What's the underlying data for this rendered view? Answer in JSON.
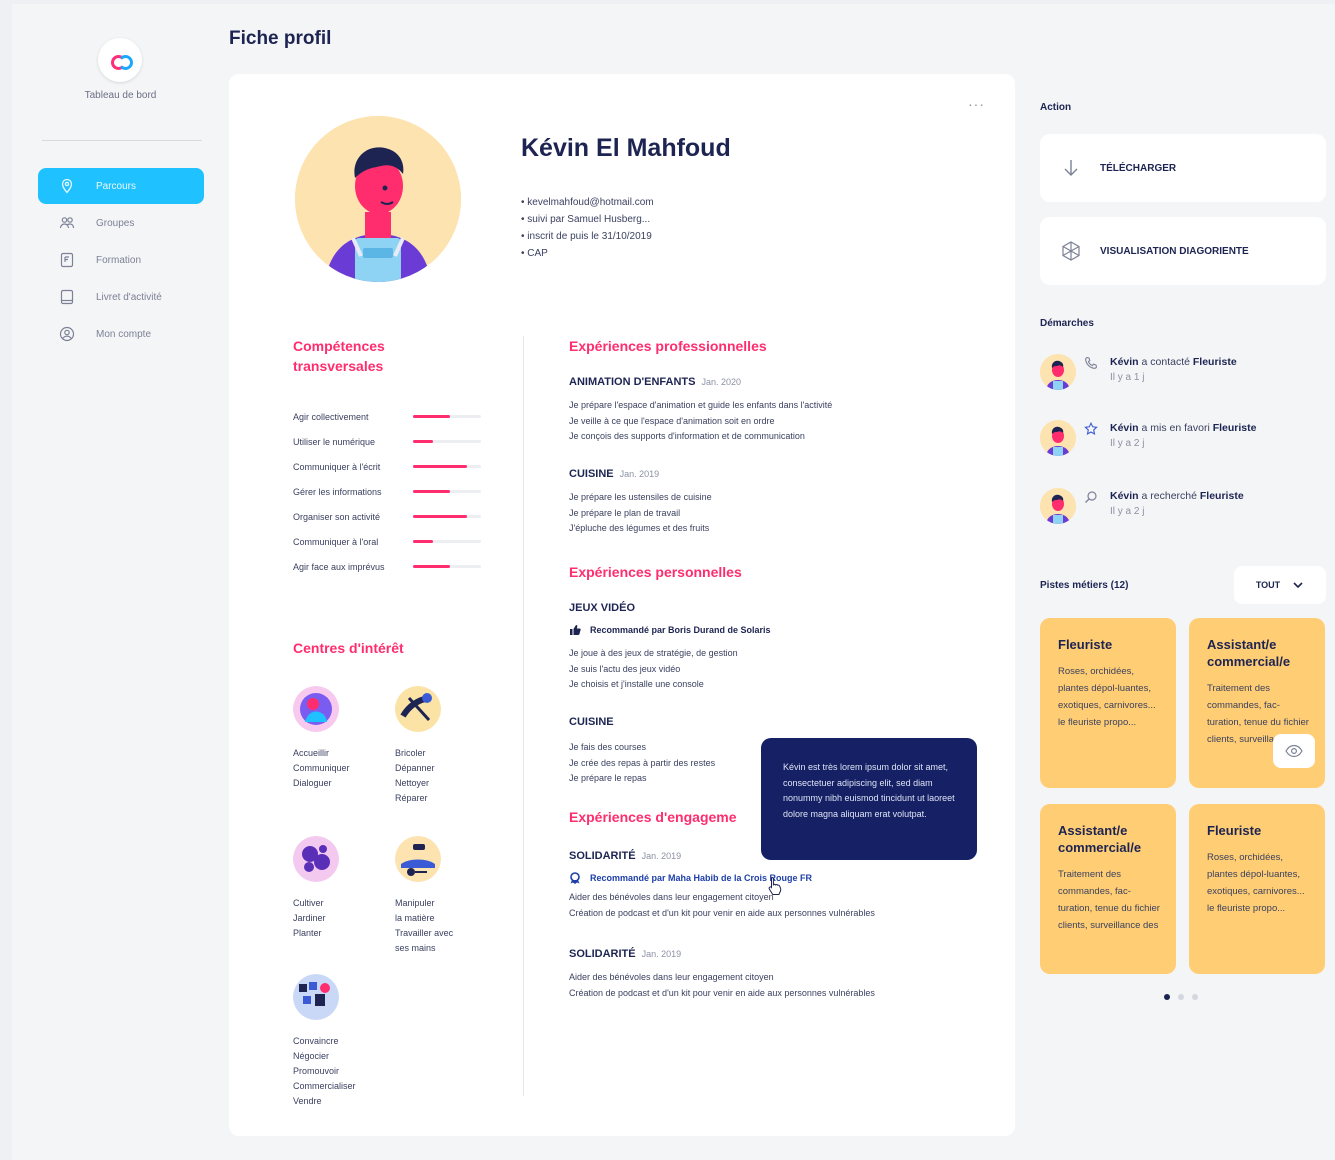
{
  "sidebar": {
    "logo_label": "Tableau de bord",
    "items": [
      {
        "label": "Parcours",
        "icon": "map-pin-icon",
        "active": true
      },
      {
        "label": "Groupes",
        "icon": "users-icon"
      },
      {
        "label": "Formation",
        "icon": "formation-icon"
      },
      {
        "label": "Livret d'activité",
        "icon": "book-icon"
      },
      {
        "label": "Mon compte",
        "icon": "user-circle-icon"
      }
    ]
  },
  "page": {
    "title": "Fiche profil"
  },
  "profile": {
    "more": "···",
    "name": "Kévin El Mahfoud",
    "meta": [
      "kevelmahfoud@hotmail.com",
      "suivi par Samuel Husberg...",
      "inscrit de puis le 31/10/2019",
      "CAP"
    ]
  },
  "skills": {
    "title_line1": "Compétences",
    "title_line2": "transversales",
    "items": [
      {
        "label": "Agir collectivement",
        "level": 0.55
      },
      {
        "label": "Utiliser le numérique",
        "level": 0.3
      },
      {
        "label": "Communiquer à l'écrit",
        "level": 0.8
      },
      {
        "label": "Gérer les informations",
        "level": 0.55
      },
      {
        "label": "Organiser son activité",
        "level": 0.8
      },
      {
        "label": "Communiquer à l'oral",
        "level": 0.3
      },
      {
        "label": "Agir face aux imprévus",
        "level": 0.55
      }
    ]
  },
  "interests": {
    "title": "Centres d'intérêt",
    "items": [
      {
        "lines": [
          "Accueillir",
          "Communiquer",
          "Dialoguer"
        ]
      },
      {
        "lines": [
          "Bricoler",
          "Dépanner",
          "Nettoyer",
          "Réparer"
        ]
      },
      {
        "lines": [
          "Cultiver",
          "Jardiner",
          "Planter"
        ]
      },
      {
        "lines": [
          "Manipuler",
          "la matière",
          "Travailler avec",
          "ses mains"
        ]
      },
      {
        "lines": [
          "Convaincre",
          "Négocier",
          "Promouvoir",
          "Commercialiser",
          "Vendre"
        ]
      }
    ]
  },
  "experiences": {
    "pro_title": "Expériences professionnelles",
    "pro": [
      {
        "title": "ANIMATION D'ENFANTS",
        "date": "Jan. 2020",
        "lines": [
          "Je prépare l'espace d'animation et guide les enfants dans l'activité",
          "Je veille à ce que l'espace d'animation soit en ordre",
          "Je conçois des supports d'information et de communication"
        ]
      },
      {
        "title": "CUISINE",
        "date": "Jan. 2019",
        "lines": [
          "Je prépare les ustensiles de cuisine",
          "Je prépare le plan de travail",
          "J'épluche des légumes et des fruits"
        ]
      }
    ],
    "perso_title": "Expériences personnelles",
    "perso": [
      {
        "title": "JEUX VIDÉO",
        "reco": "Recommandé par Boris Durand de Solaris",
        "lines": [
          "Je joue à des jeux de stratégie, de gestion",
          "Je suis l'actu des jeux vidéo",
          "Je choisis et j'installe une console"
        ]
      },
      {
        "title": "CUISINE",
        "lines": [
          "Je fais des courses",
          "Je crée des repas à partir des restes",
          "Je prépare le repas"
        ]
      }
    ],
    "engage_title": "Expériences d'engageme",
    "engage": [
      {
        "title": "SOLIDARITÉ",
        "date": "Jan. 2019",
        "reco": "Recommandé par Maha Habib de la Crois Rouge FR",
        "lines": [
          "Aider des bénévoles dans leur engagement citoyen",
          "Création de podcast et d'un kit pour venir en aide aux personnes vulnérables"
        ]
      },
      {
        "title": "SOLIDARITÉ",
        "date": "Jan. 2019",
        "lines": [
          "Aider des bénévoles dans leur engagement citoyen",
          "Création de podcast et d'un kit pour venir en aide aux personnes vulnérables"
        ]
      }
    ]
  },
  "tooltip": {
    "text": "Kévin est très lorem ipsum dolor sit amet, consectetuer adipiscing elit, sed diam nonummy nibh euismod tincidunt ut laoreet dolore magna aliquam erat volutpat."
  },
  "right": {
    "action_label": "Action",
    "download": "TÉLÉCHARGER",
    "visualisation": "VISUALISATION DIAGORIENTE",
    "steps_label": "Démarches",
    "steps": [
      {
        "actor": "Kévin",
        "action": "a contacté",
        "target": "Fleuriste",
        "time": "Il y a 1 j",
        "icon": "phone-icon"
      },
      {
        "actor": "Kévin",
        "action": "a mis en favori",
        "target": "Fleuriste",
        "time": "Il y a 2 j",
        "icon": "star-icon"
      },
      {
        "actor": "Kévin",
        "action": "a recherché",
        "target": "Fleuriste",
        "time": "Il y a 2 j",
        "icon": "search-icon"
      }
    ],
    "jobs_label": "Pistes métiers",
    "jobs_count": "(12)",
    "filter": "TOUT",
    "jobs": [
      {
        "title": "Fleuriste",
        "desc": "Roses, orchidées, plantes dépol-luantes, exotiques, carnivores... le fleuriste propo..."
      },
      {
        "title": "Assistant/e commercial/e",
        "desc": "Traitement des commandes, fac-turation, tenue du fichier clients, surveillance des"
      },
      {
        "title": "Assistant/e commercial/e",
        "desc": "Traitement des commandes, fac-turation, tenue du fichier clients, surveillance des"
      },
      {
        "title": "Fleuriste",
        "desc": "Roses, orchidées, plantes dépol-luantes, exotiques, carnivores... le fleuriste propo..."
      }
    ]
  },
  "colors": {
    "accent": "#1fc2ff",
    "pink": "#ff2d6e",
    "navy": "#1d2452",
    "card_yellow": "#ffcd73"
  }
}
